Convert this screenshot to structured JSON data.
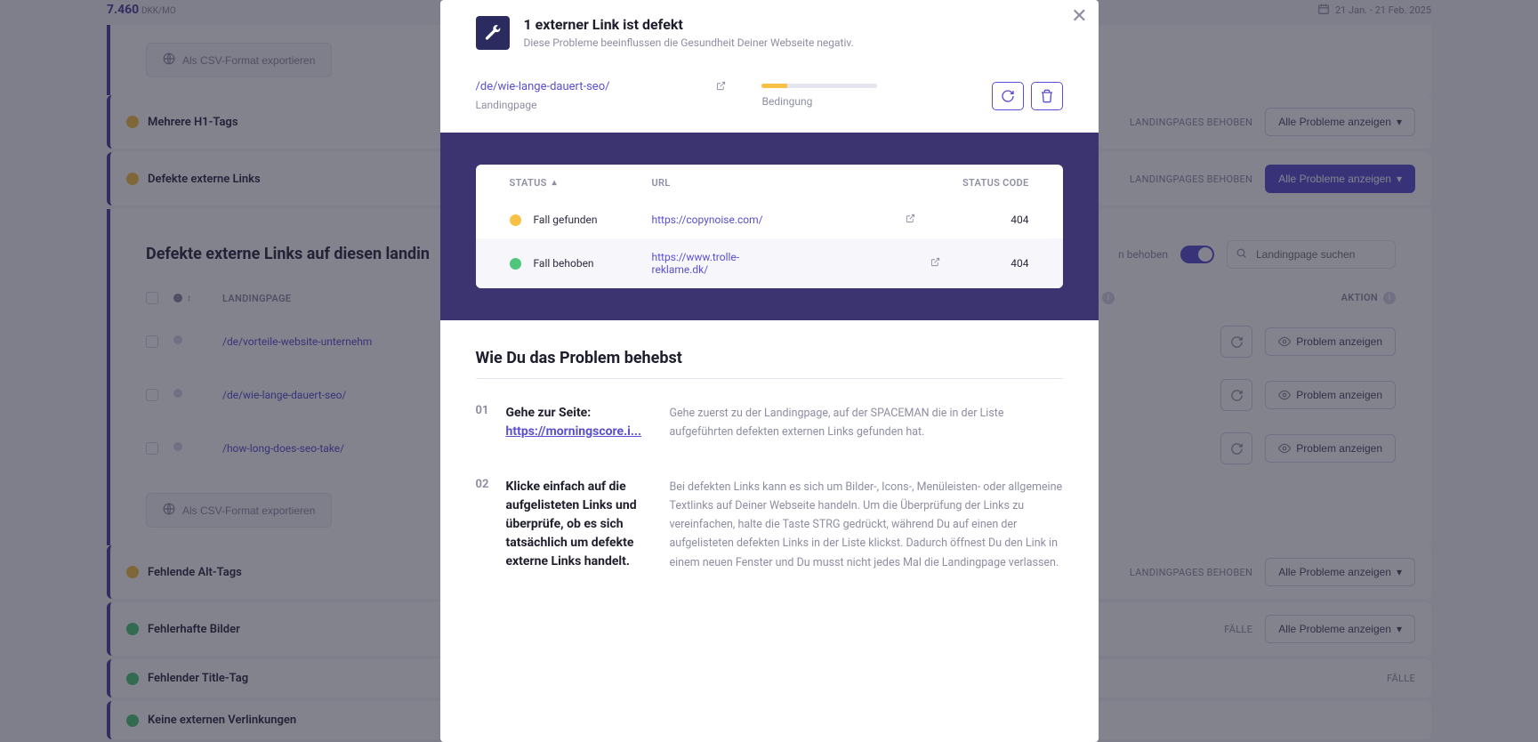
{
  "bg": {
    "price": "7.460",
    "price_unit": "DKK/MO",
    "daterange": "21 Jan. - 21 Feb. 2025",
    "export_label": "Als CSV-Format exportieren",
    "issues": [
      {
        "status": "warn",
        "title": "Mehrere H1-Tags",
        "meta": "LANDINGPAGES BEHOBEN",
        "btn": "Alle Probleme anzeigen",
        "btn_primary": false
      },
      {
        "status": "warn",
        "title": "Defekte externe Links",
        "meta": "LANDINGPAGES BEHOBEN",
        "btn": "Alle Probleme anzeigen",
        "btn_primary": true
      }
    ],
    "expanded": {
      "section_title": "Defekte externe Links auf diesen landin",
      "toggle_label": "n behoben",
      "search_placeholder": "Landingpage suchen",
      "th_landingpage": "LANDINGPAGE",
      "th_aktion": "AKTION",
      "rows": [
        {
          "url": "/de/vorteile-website-unternehm",
          "action": "Problem anzeigen"
        },
        {
          "url": "/de/wie-lange-dauert-seo/",
          "action": "Problem anzeigen"
        },
        {
          "url": "/how-long-does-seo-take/",
          "action": "Problem anzeigen"
        }
      ]
    },
    "lower_issues": [
      {
        "status": "warn",
        "title": "Fehlende Alt-Tags",
        "meta": "LANDINGPAGES BEHOBEN",
        "btn": "Alle Probleme anzeigen"
      },
      {
        "status": "ok",
        "title": "Fehlerhafte Bilder",
        "meta": "Fälle",
        "btn": "Alle Probleme anzeigen"
      },
      {
        "status": "ok",
        "title": "Fehlender Title-Tag",
        "meta": "Fälle",
        "btn": ""
      },
      {
        "status": "ok",
        "title": "Keine externen Verlinkungen",
        "meta": "",
        "btn": ""
      }
    ]
  },
  "modal": {
    "title": "1 externer Link ist defekt",
    "subtitle": "Diese Probleme beeinflussen die Gesundheit Deiner Webseite negativ.",
    "page_link": "/de/wie-lange-dauert-seo/",
    "page_label": "Landingpage",
    "condition_label": "Bedingung",
    "table": {
      "th_status": "STATUS",
      "th_url": "URL",
      "th_code": "STATUS CODE",
      "rows": [
        {
          "status": "warn",
          "status_text": "Fall gefunden",
          "url": "https://copynoise.com/",
          "code": "404"
        },
        {
          "status": "ok",
          "status_text": "Fall behoben",
          "url": "https://www.trolle-reklame.dk/",
          "code": "404"
        }
      ]
    },
    "howto": {
      "title": "Wie Du das Problem behebst",
      "steps": [
        {
          "num": "01",
          "left_prefix": "Gehe zur Seite:",
          "left_link": "https://morningscore.i...",
          "right": "Gehe zuerst zu der Landingpage, auf der SPACEMAN die in der Liste aufgeführten defekten externen Links gefunden hat."
        },
        {
          "num": "02",
          "left_prefix": "Klicke einfach auf die aufgelisteten Links und überprüfe, ob es sich tatsächlich um defekte externe Links handelt.",
          "left_link": "",
          "right": "Bei defekten Links kann es sich um Bilder-, Icons-, Menüleisten- oder allgemeine Textlinks auf Deiner Webseite handeln. Um die Überprüfung der Links zu vereinfachen, halte die Taste STRG gedrückt, während Du auf einen der aufgelisteten defekten Links in der Liste klickst. Dadurch öffnest Du den Link in einem neuen Fenster und Du musst nicht jedes Mal die Landingpage verlassen."
        }
      ]
    }
  }
}
